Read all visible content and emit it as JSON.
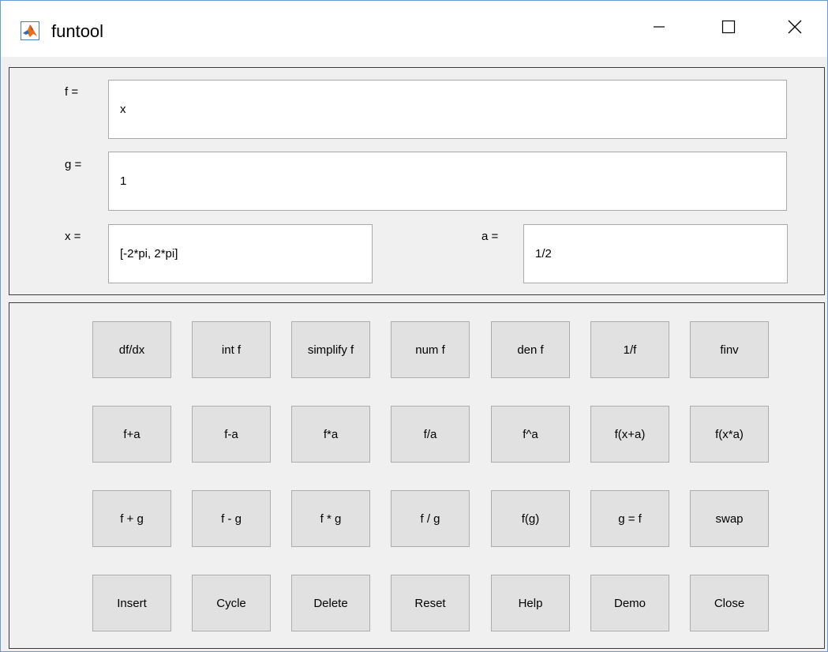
{
  "window": {
    "title": "funtool",
    "minimize_glyph": "—",
    "icon": "matlab-icon"
  },
  "fields": {
    "f": {
      "label": "f =",
      "value": "x"
    },
    "g": {
      "label": "g =",
      "value": "1"
    },
    "x": {
      "label": "x =",
      "value": "[-2*pi, 2*pi]"
    },
    "a": {
      "label": "a =",
      "value": "1/2"
    }
  },
  "buttons": [
    [
      "df/dx",
      "int f",
      "simplify f",
      "num f",
      "den f",
      "1/f",
      "finv"
    ],
    [
      "f+a",
      "f-a",
      "f*a",
      "f/a",
      "f^a",
      "f(x+a)",
      "f(x*a)"
    ],
    [
      "f + g",
      "f - g",
      "f * g",
      "f / g",
      "f(g)",
      "g = f",
      "swap"
    ],
    [
      "Insert",
      "Cycle",
      "Delete",
      "Reset",
      "Help",
      "Demo",
      "Close"
    ]
  ]
}
